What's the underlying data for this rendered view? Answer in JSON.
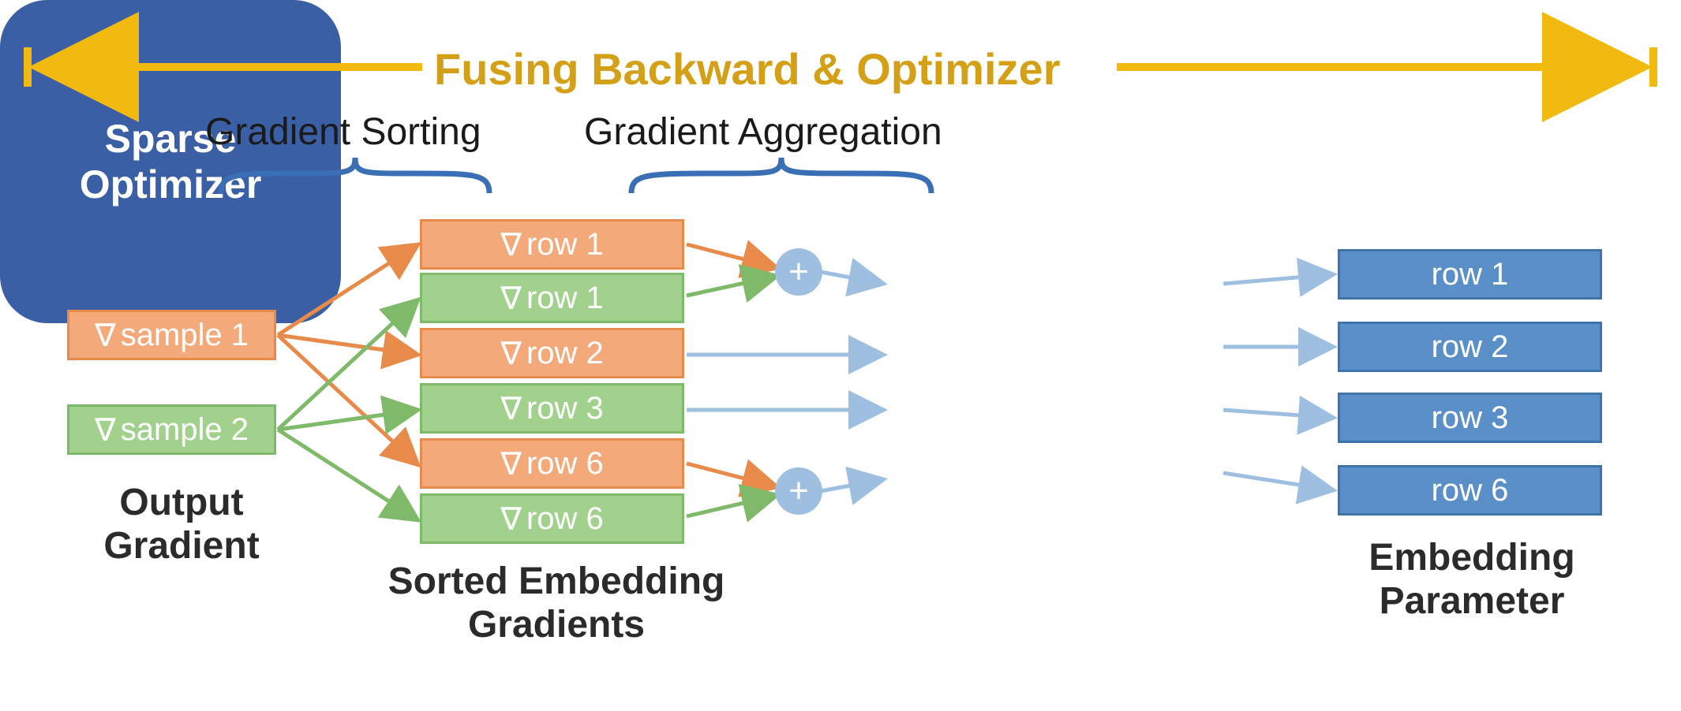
{
  "title": "Fusing Backward & Optimizer",
  "annot": {
    "sort": "Gradient Sorting",
    "agg": "Gradient Aggregation"
  },
  "colors": {
    "orange": "#f4a97a",
    "green": "#a2d18e",
    "blue": "#5a8fc7",
    "optimizer": "#3a5fa5",
    "title": "#d4a017",
    "brace": "#3b6fb5",
    "arrow_orange": "#e88b4a",
    "arrow_green": "#7fb96a",
    "arrow_blue": "#9ebfe0",
    "arrow_gold": "#f2b90f"
  },
  "samples": [
    {
      "label": "sample 1",
      "color": "orange"
    },
    {
      "label": "sample 2",
      "color": "green"
    }
  ],
  "sorted_rows": [
    {
      "label": "row 1",
      "color": "orange"
    },
    {
      "label": "row 1",
      "color": "green"
    },
    {
      "label": "row 2",
      "color": "orange"
    },
    {
      "label": "row 3",
      "color": "green"
    },
    {
      "label": "row 6",
      "color": "orange"
    },
    {
      "label": "row 6",
      "color": "green"
    }
  ],
  "out_rows": [
    "row 1",
    "row 2",
    "row 3",
    "row 6"
  ],
  "optimizer_lines": [
    "Sparse",
    "Optimizer"
  ],
  "captions": {
    "output_grad": [
      "Output",
      "Gradient"
    ],
    "sorted": [
      "Sorted Embedding",
      "Gradients"
    ],
    "embed_param": [
      "Embedding",
      "Parameter"
    ]
  },
  "plus_glyph": "+"
}
